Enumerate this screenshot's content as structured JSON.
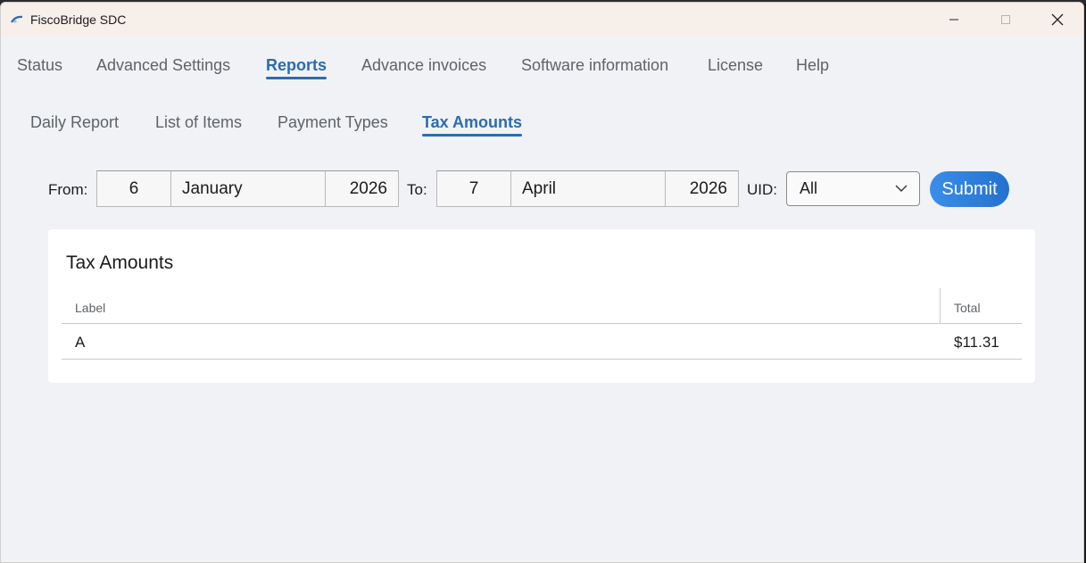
{
  "window": {
    "title": "FiscoBridge SDC"
  },
  "main_tabs": [
    {
      "label": "Status"
    },
    {
      "label": "Advanced Settings"
    },
    {
      "label": "Reports"
    },
    {
      "label": "Advance invoices"
    },
    {
      "label": "Software information"
    },
    {
      "label": "License"
    },
    {
      "label": "Help"
    }
  ],
  "sub_tabs": [
    {
      "label": "Daily Report"
    },
    {
      "label": "List of Items"
    },
    {
      "label": "Payment Types"
    },
    {
      "label": "Tax Amounts"
    }
  ],
  "filter": {
    "from_label": "From:",
    "from_day": "6",
    "from_month": "January",
    "from_year": "2026",
    "to_label": "To:",
    "to_day": "7",
    "to_month": "April",
    "to_year": "2026",
    "uid_label": "UID:",
    "uid_value": "All",
    "submit_label": "Submit"
  },
  "card": {
    "title": "Tax Amounts",
    "columns": [
      "Label",
      "Total"
    ],
    "rows": [
      {
        "label": "A",
        "total": "$11.31"
      }
    ]
  },
  "colors": {
    "accent": "#2b6cb0",
    "submit": "#2f7fdc"
  }
}
